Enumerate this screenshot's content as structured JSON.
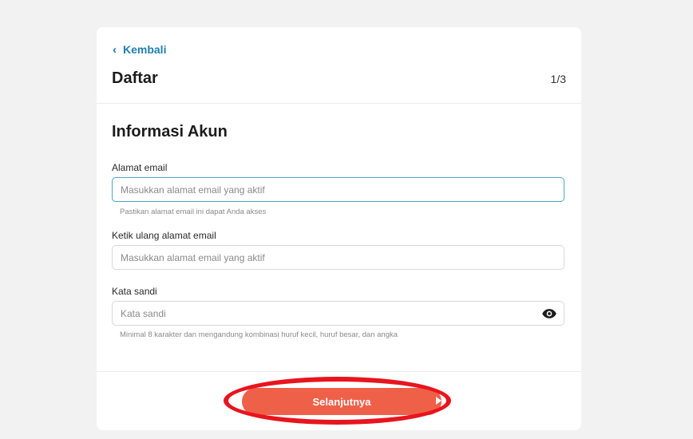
{
  "header": {
    "back_label": "Kembali",
    "title": "Daftar",
    "step": "1/3"
  },
  "section": {
    "title": "Informasi Akun"
  },
  "fields": {
    "email": {
      "label": "Alamat email",
      "placeholder": "Masukkan alamat email yang aktif",
      "value": "",
      "hint": "Pastikan alamat email ini dapat Anda akses"
    },
    "email_confirm": {
      "label": "Ketik ulang alamat email",
      "placeholder": "Masukkan alamat email yang aktif",
      "value": ""
    },
    "password": {
      "label": "Kata sandi",
      "placeholder": "Kata sandi",
      "value": "",
      "hint": "Minimal 8 karakter dan mengandung kombinasi huruf kecil, huruf besar, dan angka",
      "toggle_icon": "eye-icon"
    }
  },
  "footer": {
    "next_label": "Selanjutnya"
  },
  "colors": {
    "accent_link": "#1e7fb0",
    "button": "#ef6049",
    "annotation_ring": "#e8141e",
    "focus_border": "#4aa8c8"
  }
}
